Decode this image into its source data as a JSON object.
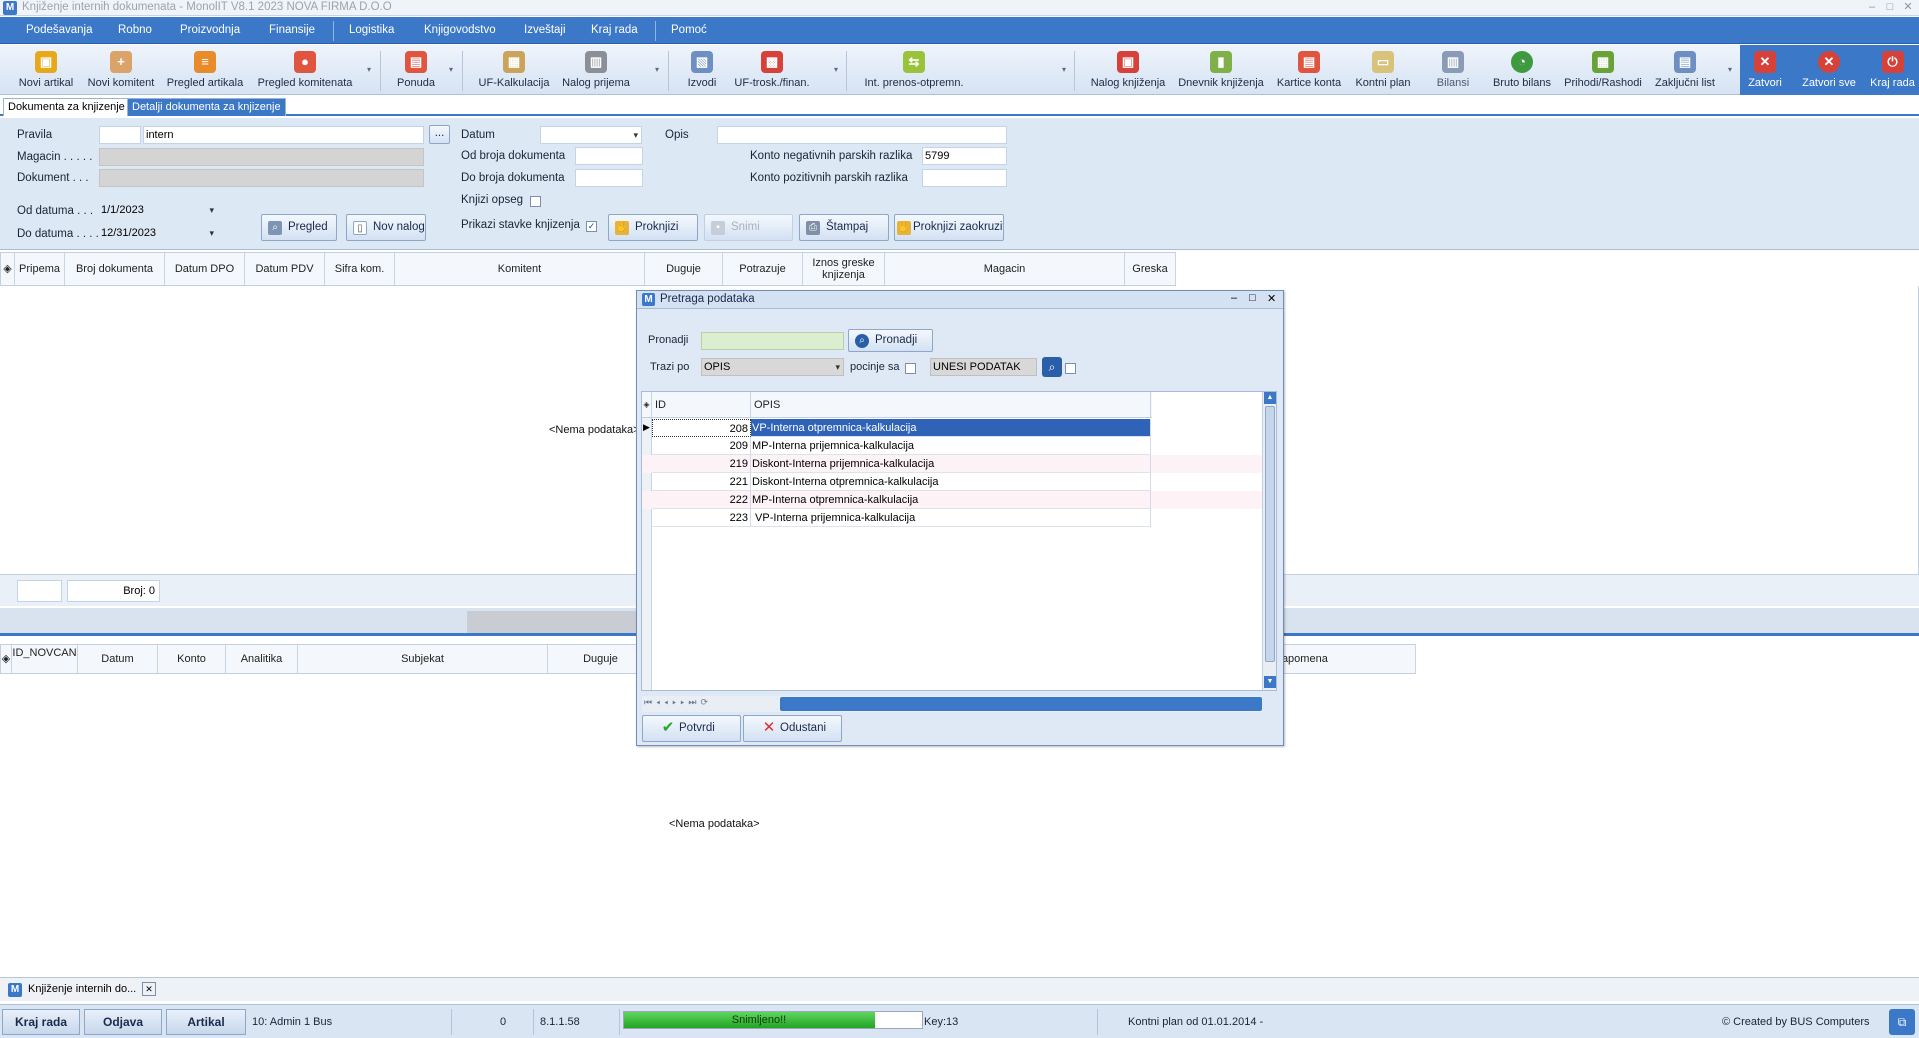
{
  "window": {
    "title": "Knjiženje internih dokumenata - MonolIT V8.1 2023 NOVA FIRMA D.O.O",
    "app_icon": "M"
  },
  "menu": [
    "Podešavanja",
    "Robno",
    "Proizvodnja",
    "Finansije",
    "Logistika",
    "Knjigovodstvo",
    "Izveštaji",
    "Kraj rada",
    "Pomoć"
  ],
  "toolbar": {
    "items": [
      {
        "label": "Novi artikal",
        "icon": "box-icon",
        "color": "#e8a81c"
      },
      {
        "label": "Novi komitent",
        "icon": "user-add-icon",
        "color": "#d9a36a"
      },
      {
        "label": "Pregled artikala",
        "icon": "items-icon",
        "color": "#e88b2b"
      },
      {
        "label": "Pregled komitenata",
        "icon": "customers-icon",
        "color": "#e0553f"
      },
      {
        "label": "Ponuda",
        "icon": "offer-icon",
        "color": "#e0553f"
      },
      {
        "label": "UF-Kalkulacija",
        "icon": "calc-icon",
        "color": "#c9a45a"
      },
      {
        "label": "Nalog prijema",
        "icon": "receipt-icon",
        "color": "#8b8f98"
      },
      {
        "label": "Izvodi",
        "icon": "statement-icon",
        "color": "#6d8fc2"
      },
      {
        "label": "UF-trosk./finan.",
        "icon": "cost-icon",
        "color": "#d6413a"
      },
      {
        "label": "Int. prenos-otpremn.",
        "icon": "transfer-icon",
        "color": "#9ac23a"
      },
      {
        "label": "Nalog knjiženja",
        "icon": "book-icon",
        "color": "#d6413a"
      },
      {
        "label": "Dnevnik knjiženja",
        "icon": "journal-icon",
        "color": "#7fb04a"
      },
      {
        "label": "Kartice konta",
        "icon": "cards-icon",
        "color": "#e0553f"
      },
      {
        "label": "Kontni plan",
        "icon": "plan-icon",
        "color": "#d9c27a"
      },
      {
        "label": "Bilansi",
        "icon": "balance-icon",
        "color": "#8a9bb8"
      },
      {
        "label": "Bruto bilans",
        "icon": "pie-icon",
        "color": "#3f9a3f"
      },
      {
        "label": "Prihodi/Rashodi",
        "icon": "income-icon",
        "color": "#6aa23a"
      },
      {
        "label": "Zaključni list",
        "icon": "closing-icon",
        "color": "#6d8fc2"
      }
    ],
    "right": [
      {
        "label": "Zatvori",
        "icon": "close-icon"
      },
      {
        "label": "Zatvori sve",
        "icon": "close-all-icon"
      },
      {
        "label": "Kraj rada",
        "icon": "power-icon"
      }
    ]
  },
  "tabs": [
    "Dokumenta za knjizenje",
    "Detalji dokumenta za knjizenje"
  ],
  "form": {
    "pravila_label": "Pravila",
    "pravila_code": "",
    "pravila_value": "intern",
    "magacin_label": "Magacin . . . . .",
    "dokument_label": "Dokument . . .",
    "od_datuma_label": "Od datuma . . .",
    "od_datuma_value": "1/1/2023",
    "do_datuma_label": "Do datuma . . . .",
    "do_datuma_value": "12/31/2023",
    "browse_label": "...",
    "datum_label": "Datum",
    "datum_value": "",
    "od_broja_label": "Od broja dokumenta",
    "do_broja_label": "Do broja dokumenta",
    "knjizi_opseg_label": "Knjizi opseg",
    "prikazi_stavke_label": "Prikazi stavke knjizenja",
    "opis_label": "Opis",
    "konto_neg_label": "Konto negativnih parskih razlika",
    "konto_neg_value": "5799",
    "konto_poz_label": "Konto pozitivnih parskih razlika",
    "konto_poz_value": ""
  },
  "buttons": {
    "pregled": "Pregled",
    "nov_nalog": "Nov nalog",
    "proknjizi": "Proknjizi",
    "snimi": "Snimi",
    "stampaj": "Štampaj",
    "proknjizi_zaokruz": "Proknjizi zaokruzivanje"
  },
  "grid1": {
    "columns": [
      "Pripema",
      "Broj dokumenta",
      "Datum DPO",
      "Datum PDV",
      "Sifra kom.",
      "Komitent",
      "Duguje",
      "Potrazuje",
      "Iznos greske knjizenja",
      "Magacin",
      "Greska"
    ],
    "empty_text": "<Nema podataka>",
    "count_label": "Broj: 0"
  },
  "grid2": {
    "columns": [
      "ID_NOVCAN",
      "Datum",
      "Konto",
      "Analitika",
      "Subjekat",
      "Duguje"
    ],
    "tail_column": "Napomena",
    "empty_text": "<Nema podataka>"
  },
  "dialog": {
    "title": "Pretraga podataka",
    "pronadji_label": "Pronadji",
    "pronadji_value": "",
    "pronadji_button": "Pronadji",
    "trazi_po_label": "Trazi po",
    "trazi_po_value": "OPIS",
    "pocinje_sa_label": "pocinje sa",
    "unesi_podatak": "UNESI PODATAK",
    "columns": [
      "ID",
      "OPIS"
    ],
    "rows": [
      {
        "id": "208",
        "opis": "VP-Interna otpremnica-kalkulacija"
      },
      {
        "id": "209",
        "opis": "MP-Interna prijemnica-kalkulacija"
      },
      {
        "id": "219",
        "opis": "Diskont-Interna prijemnica-kalkulacija"
      },
      {
        "id": "221",
        "opis": "Diskont-Interna otpremnica-kalkulacija"
      },
      {
        "id": "222",
        "opis": "MP-Interna otpremnica-kalkulacija"
      },
      {
        "id": "223",
        "opis": " VP-Interna prijemnica-kalkulacija"
      }
    ],
    "potvrdi": "Potvrdi",
    "odustani": "Odustani"
  },
  "taskbar": {
    "item": "Knjiženje internih do..."
  },
  "statusbar": {
    "kraj_rada": "Kraj rada",
    "odjava": "Odjava",
    "artikal": "Artikal",
    "user": "10: Admin 1 Bus",
    "num": "0",
    "version": "8.1.1.58",
    "progress_text": "Snimljeno!!",
    "progress": 0.93,
    "key": "Key:13",
    "kontni_plan": "Kontni plan od 01.01.2014 -",
    "created_by": "© Created by BUS Computers"
  },
  "colors": {
    "accent": "#3c78c8",
    "selection": "#2f63b8",
    "progress": "#2fb52f"
  }
}
